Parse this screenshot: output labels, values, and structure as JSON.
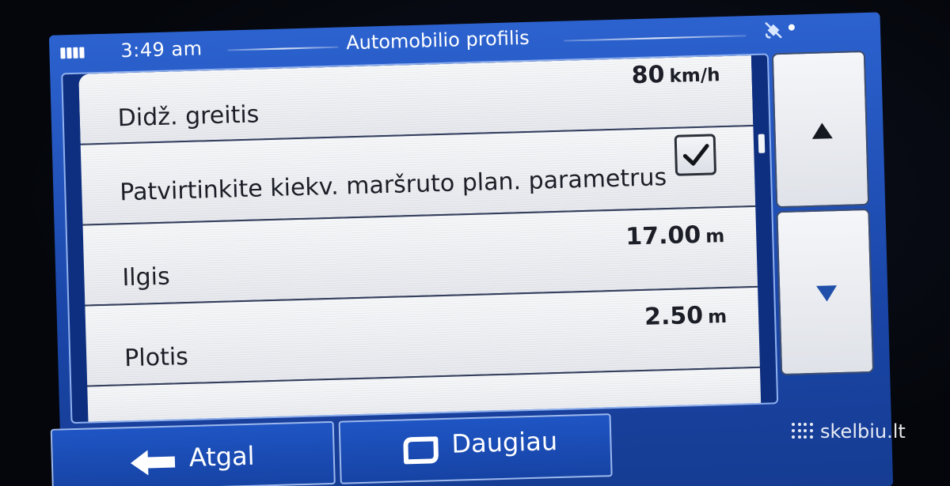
{
  "status_bar": {
    "time": "3:49 am",
    "title": "Automobilio profilis"
  },
  "list": {
    "items": [
      {
        "label": "Didž. greitis",
        "value": "80",
        "unit": "km/h"
      },
      {
        "label": "Patvirtinkite kiekv. maršruto plan. parametrus",
        "checked": true
      },
      {
        "label": "Ilgis",
        "value": "17.00",
        "unit": "m"
      },
      {
        "label": "Plotis",
        "value": "2.50",
        "unit": "m"
      }
    ]
  },
  "footer": {
    "back_label": "Atgal",
    "more_label": "Daugiau"
  },
  "watermark": {
    "text": "skelbiu.lt"
  },
  "colors": {
    "screen_blue": "#1e4fb8",
    "list_background": "#eceef2",
    "text_dark": "#1b1e26",
    "scroll_arrow": "#1f4fa8"
  },
  "icons": {
    "battery": "battery-icon",
    "satellite": "satellite-icon",
    "checkbox": "checkmark-icon",
    "scroll_up": "triangle-up-icon",
    "scroll_down": "triangle-down-icon",
    "back": "arrow-left-icon",
    "more": "rounded-square-icon"
  }
}
